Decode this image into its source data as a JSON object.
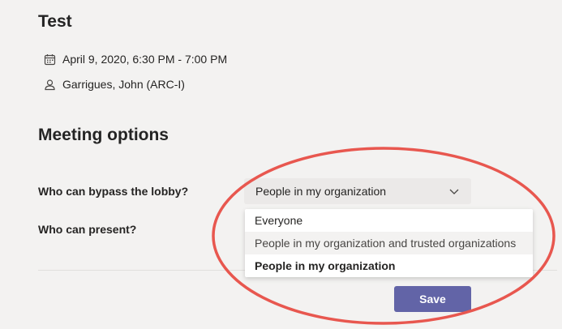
{
  "meeting": {
    "title": "Test",
    "datetime": "April 9, 2020, 6:30 PM - 7:00 PM",
    "organizer": "Garrigues, John (ARC-I)"
  },
  "options": {
    "section_title": "Meeting options",
    "lobby_label": "Who can bypass the lobby?",
    "present_label": "Who can present?",
    "lobby_selected": "People in my organization",
    "dropdown_options": [
      "Everyone",
      "People in my organization and trusted organizations",
      "People in my organization"
    ],
    "save_label": "Save"
  },
  "icons": {
    "date": "calendar-icon",
    "organizer": "person-icon",
    "select": "chevron-down-icon"
  },
  "colors": {
    "accent": "#6264a7",
    "highlight_ring": "#e8574f"
  }
}
